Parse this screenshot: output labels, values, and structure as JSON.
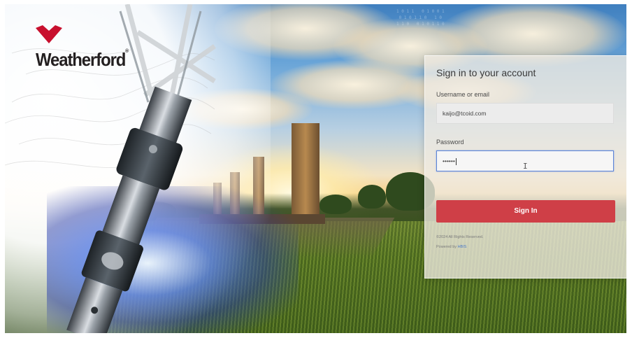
{
  "brand": {
    "name": "Weatherford",
    "logo_color": "#c8102e"
  },
  "login": {
    "title": "Sign in to your account",
    "username_label": "Username or email",
    "username_value": "kaijo@tcoid.com",
    "password_label": "Password",
    "password_value": "••••••",
    "signin_label": "Sign In",
    "signin_color": "#cf3f47",
    "copyright": "©2024 All Rights Reserved.",
    "powered_by_label": "Powered by",
    "powered_by_brand": "HBIS"
  }
}
